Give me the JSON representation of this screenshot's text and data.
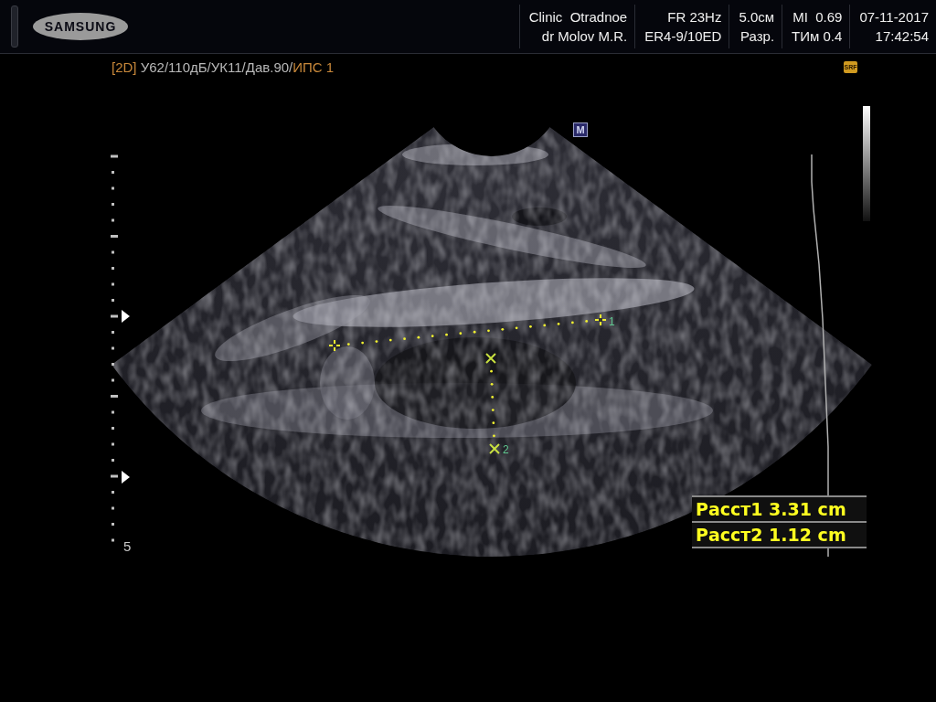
{
  "header": {
    "logo": "SAMSUNG",
    "info": [
      {
        "lines": [
          "Clinic  Otradnoe",
          "dr Molov M.R."
        ]
      },
      {
        "lines": [
          "FR 23Hz",
          "ER4-9/10ED"
        ]
      },
      {
        "lines": [
          "5.0см",
          "Разр."
        ]
      },
      {
        "lines": [
          "MI  0.69",
          "ТИм 0.4"
        ]
      },
      {
        "lines": [
          "07-11-2017",
          "17:42:54"
        ]
      }
    ]
  },
  "params": [
    {
      "text": "[2D] ",
      "color": "#c8883a"
    },
    {
      "text": "У62/110дБ/УК11/Дав.90/",
      "color": "#b8b8b8"
    },
    {
      "text": "ИПС 1",
      "color": "#c8883a"
    }
  ],
  "srf_badge": "SRF",
  "marker_badge": "M",
  "depth_label": "5",
  "calipers": [
    {
      "label": "1"
    },
    {
      "label": "2"
    }
  ],
  "measurements": [
    "Расст1 3.31 cm",
    "Расст2 1.12 cm"
  ]
}
